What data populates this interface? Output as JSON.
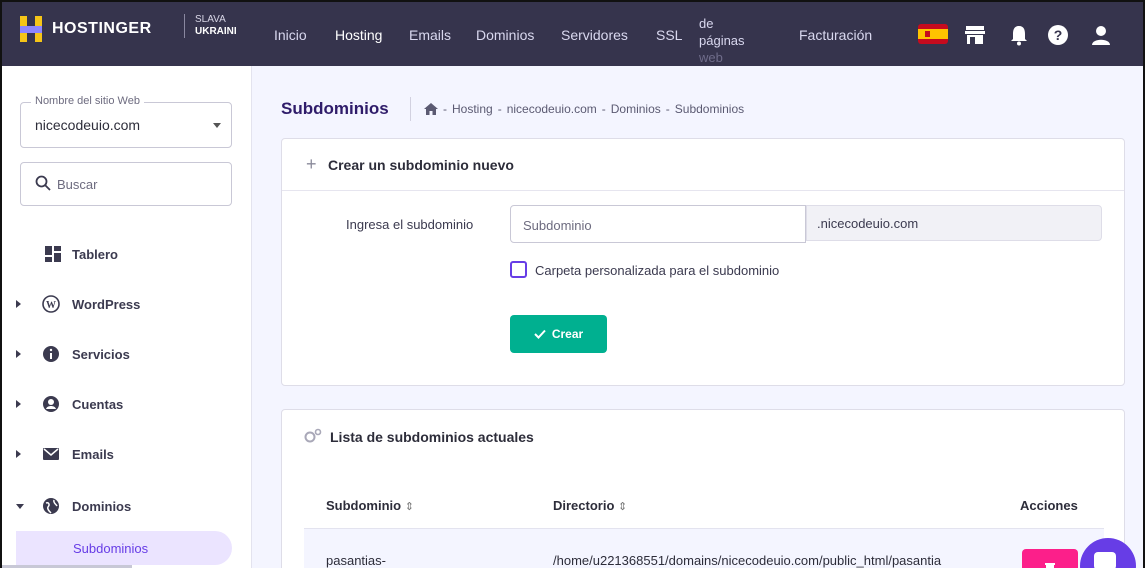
{
  "topbar": {
    "brand": "HOSTINGER",
    "badge_line1": "SLAVA",
    "badge_line2": "UKRAINI",
    "nav": [
      "Inicio",
      "Hosting",
      "Emails",
      "Dominios",
      "Servidores",
      "SSL"
    ],
    "nav_multi": [
      "de",
      "páginas",
      "web"
    ],
    "billing": "Facturación",
    "icons": [
      "spain-flag-icon",
      "store-icon",
      "bell-icon",
      "help-icon",
      "user-icon"
    ]
  },
  "sidebar": {
    "site_label": "Nombre del sitio Web",
    "site_value": "nicecodeuio.com",
    "search_placeholder": "Buscar",
    "items": [
      "Tablero",
      "WordPress",
      "Servicios",
      "Cuentas",
      "Emails",
      "Dominios"
    ],
    "subitem": "Subdominios"
  },
  "main": {
    "title": "Subdominios",
    "breadcrumb": [
      "Hosting",
      "nicecodeuio.com",
      "Dominios",
      "Subdominios"
    ],
    "breadcrumb_sep": "-",
    "create": {
      "title": "Crear un subdominio nuevo",
      "field_label": "Ingresa el subdominio",
      "placeholder": "Subdominio",
      "suffix": ".nicecodeuio.com",
      "checkbox_label": "Carpeta personalizada para el subdominio",
      "button": "Crear"
    },
    "list": {
      "title": "Lista de subdominios actuales",
      "columns": [
        "Subdominio",
        "Directorio",
        "Acciones"
      ],
      "sort_glyph": "⇕",
      "rows": [
        {
          "subdomain": "pasantias-",
          "directory": "/home/u221368551/domains/nicecodeuio.com/public_html/pasantia"
        }
      ]
    }
  },
  "colors": {
    "topbar": "#36344d",
    "accent": "#673de6",
    "success": "#00b090",
    "danger": "#fc1f8a"
  }
}
